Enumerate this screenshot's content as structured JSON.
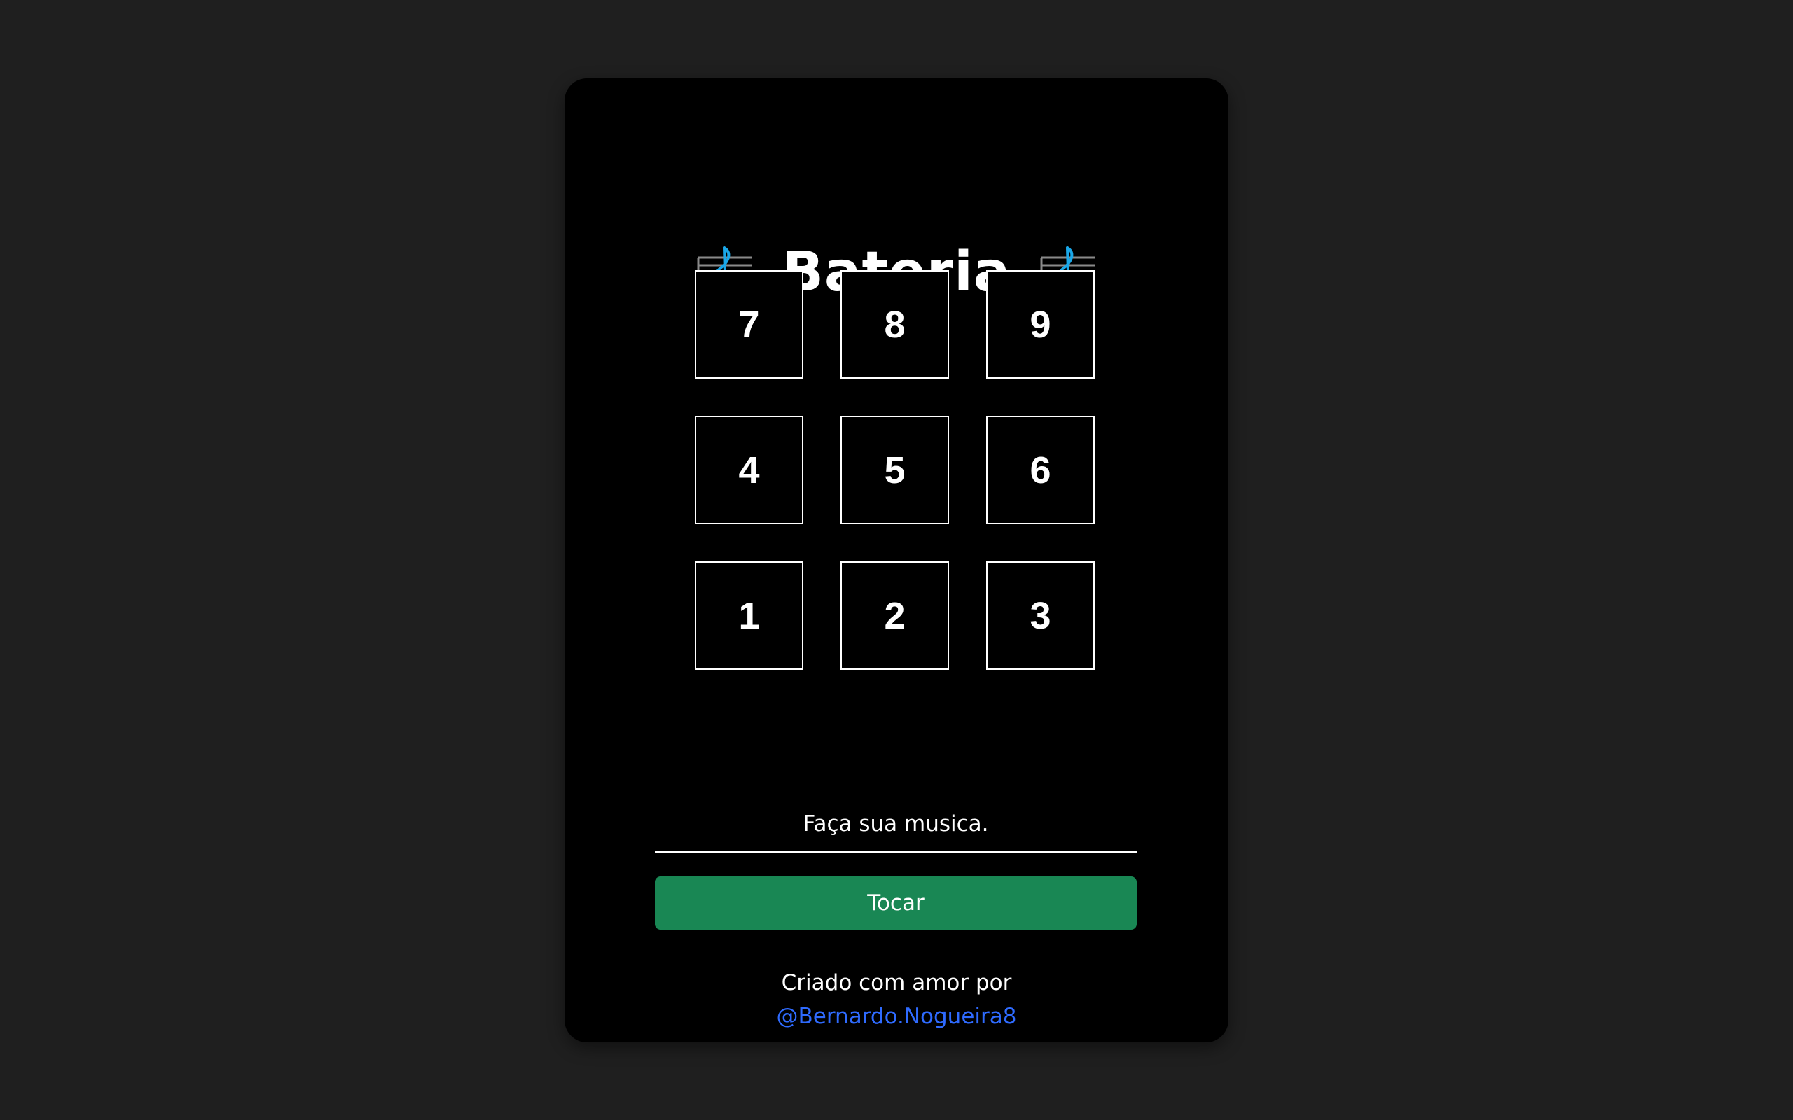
{
  "app": {
    "title": "Bateria",
    "left_icon": "treble-clef-icon",
    "right_icon": "treble-clef-icon"
  },
  "pads": [
    {
      "label": "7"
    },
    {
      "label": "8"
    },
    {
      "label": "9"
    },
    {
      "label": "4"
    },
    {
      "label": "5"
    },
    {
      "label": "6"
    },
    {
      "label": "1"
    },
    {
      "label": "2"
    },
    {
      "label": "3"
    }
  ],
  "composer": {
    "placeholder": "Faça sua musica.",
    "value": "",
    "play_label": "Tocar"
  },
  "footer": {
    "credit_text": "Criado com amor por",
    "author_link": "@Bernardo.Nogueira8"
  },
  "colors": {
    "background": "#1f1f1f",
    "card": "#000000",
    "accent_button": "#198754",
    "link": "#2f6bff",
    "clef": "#1aa7e8"
  }
}
